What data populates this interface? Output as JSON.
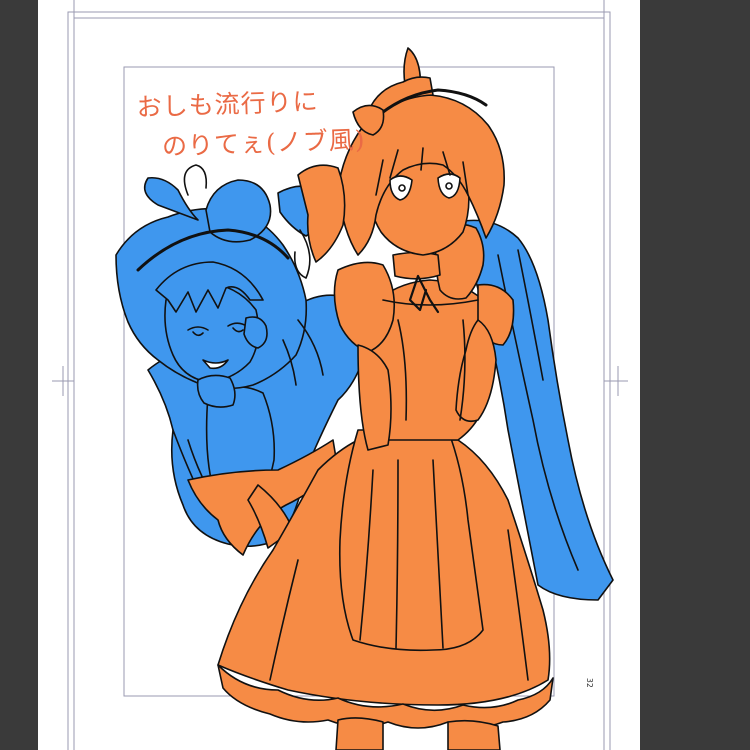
{
  "app": {
    "sidebar_color": "#3a3a3a",
    "workspace_color": "#3a3a3a",
    "page_color": "#ffffff",
    "guide_color": "#9a9ab0"
  },
  "canvas": {
    "handwritten_note": {
      "line1": "おしも流行りに",
      "line2": "のりてぇ(ノブ風)",
      "color": "#ea6a45"
    },
    "page_number": "32",
    "artwork": {
      "left_figure_color": "#3f97ee",
      "right_figure_color": "#f68b45",
      "line_color": "#111111"
    }
  }
}
